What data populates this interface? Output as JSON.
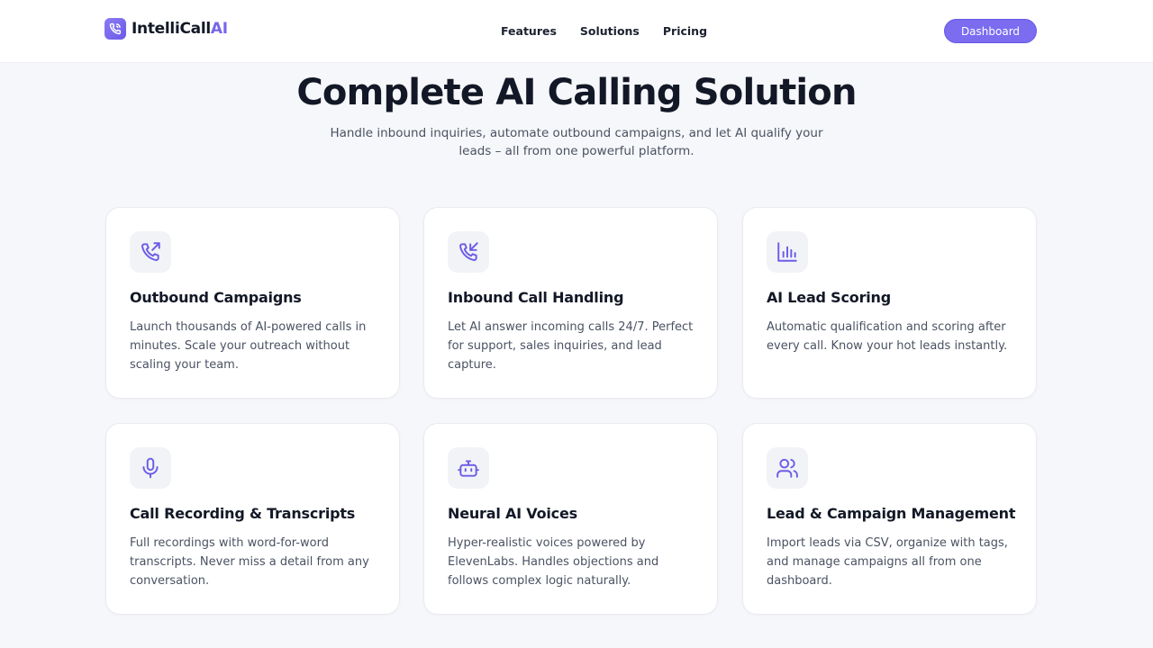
{
  "brand": {
    "name_main": "IntelliCall",
    "name_accent": "AI"
  },
  "nav": {
    "links": [
      "Features",
      "Solutions",
      "Pricing"
    ],
    "cta": "Dashboard"
  },
  "hero": {
    "title": "Complete AI Calling Solution",
    "subtitle": "Handle inbound inquiries, automate outbound campaigns, and let AI qualify your leads – all from one powerful platform."
  },
  "features": [
    {
      "icon": "phone-outgoing-icon",
      "title": "Outbound Campaigns",
      "desc": "Launch thousands of AI-powered calls in minutes. Scale your outreach without scaling your team."
    },
    {
      "icon": "phone-incoming-icon",
      "title": "Inbound Call Handling",
      "desc": "Let AI answer incoming calls 24/7. Perfect for support, sales inquiries, and lead capture."
    },
    {
      "icon": "bar-chart-icon",
      "title": "AI Lead Scoring",
      "desc": "Automatic qualification and scoring after every call. Know your hot leads instantly."
    },
    {
      "icon": "microphone-icon",
      "title": "Call Recording & Transcripts",
      "desc": "Full recordings with word-for-word transcripts. Never miss a detail from any conversation."
    },
    {
      "icon": "robot-icon",
      "title": "Neural AI Voices",
      "desc": "Hyper-realistic voices powered by ElevenLabs. Handles objections and follows complex logic naturally."
    },
    {
      "icon": "users-icon",
      "title": "Lead & Campaign Management",
      "desc": "Import leads via CSV, organize with tags, and manage campaigns all from one dashboard."
    }
  ],
  "colors": {
    "accent": "#7b6cf0",
    "icon_stroke": "#6c5ce7",
    "page_bg": "#f6f7fa"
  }
}
